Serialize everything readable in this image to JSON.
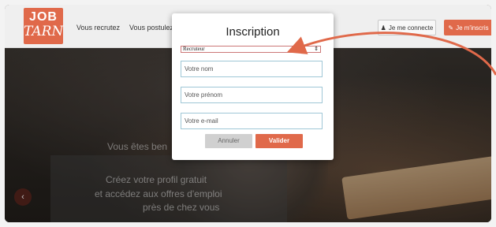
{
  "header": {
    "logo_line1": "JOB",
    "logo_line2": "TARN",
    "nav": [
      "Vous recrutez",
      "Vous postulez"
    ],
    "login_label": "Je me connecte",
    "signup_label": "Je m'inscris",
    "accent": "#e0694a"
  },
  "hero": {
    "line1": "Vous êtes ben",
    "line2": "Créez votre profil gratuit",
    "line3": "et accédez aux offres d'emploi",
    "line4": "près de chez vous"
  },
  "modal": {
    "title": "Inscription",
    "select_value": "Recruteur",
    "fields": [
      {
        "placeholder": "Votre nom"
      },
      {
        "placeholder": "Votre prénom"
      },
      {
        "placeholder": "Votre e-mail"
      }
    ],
    "cancel_label": "Annuler",
    "submit_label": "Valider"
  },
  "annotation": {
    "color": "#e0694a"
  }
}
